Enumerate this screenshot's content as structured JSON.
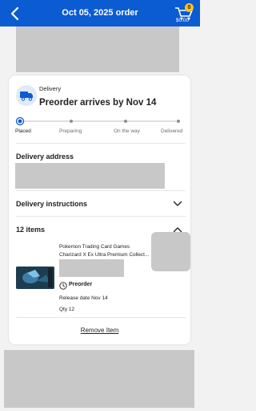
{
  "header": {
    "title": "Oct 05, 2025 order",
    "cart_count": "0",
    "cart_total": "$0.00",
    "color": "#0b5bd3"
  },
  "delivery": {
    "label": "Delivery",
    "title": "Preorder arrives by Nov 14",
    "steps": [
      "Placed",
      "Preparing",
      "On the way",
      "Delivered"
    ],
    "current_step_index": 0
  },
  "sections": {
    "address_title": "Delivery address",
    "instructions_title": "Delivery instructions",
    "items_title": "12 items"
  },
  "item": {
    "name_line1": "Pokemon Trading Card Games",
    "name_line2": "Charizard X Ex Ultra Premium Collect...",
    "preorder_label": "Preorder",
    "release": "Release date Nov 14",
    "qty": "Qty 12",
    "remove_label": "Remove Item"
  },
  "icons": [
    "back-arrow-icon",
    "cart-icon",
    "truck-icon",
    "chevron-down-icon",
    "chevron-up-icon",
    "preorder-icon"
  ]
}
